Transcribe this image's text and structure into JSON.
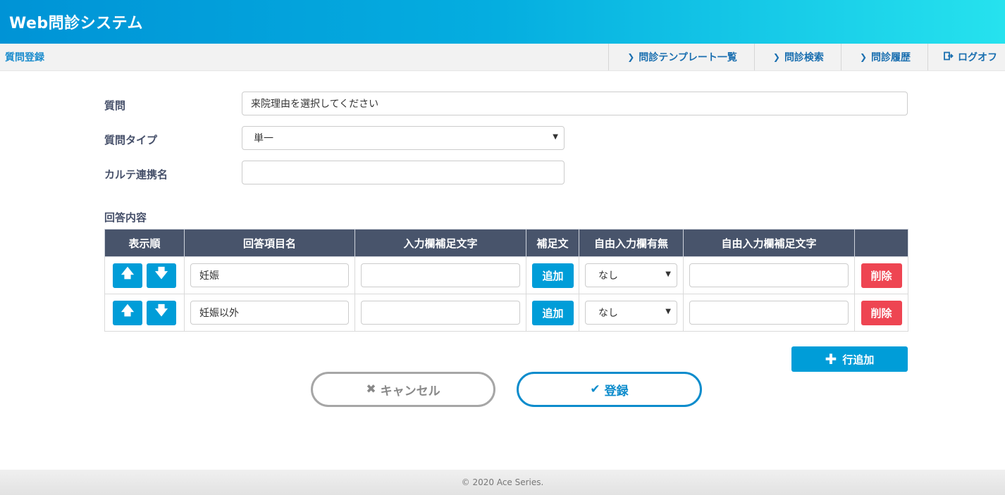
{
  "app": {
    "title": "Web問診システム"
  },
  "subnav": {
    "page_name": "質問登録",
    "links": [
      {
        "label": "問診テンプレート一覧",
        "icon": "chevron-right-icon"
      },
      {
        "label": "問診検索",
        "icon": "chevron-right-icon"
      },
      {
        "label": "問診履歴",
        "icon": "chevron-right-icon"
      },
      {
        "label": "ログオフ",
        "icon": "logout-icon"
      }
    ]
  },
  "form": {
    "question_label": "質問",
    "question_value": "来院理由を選択してください",
    "type_label": "質問タイプ",
    "type_value": "単一",
    "karte_label": "カルテ連携名",
    "karte_value": ""
  },
  "answers": {
    "section_label": "回答内容",
    "columns": [
      "表示順",
      "回答項目名",
      "入力欄補足文字",
      "補足文",
      "自由入力欄有無",
      "自由入力欄補足文字",
      ""
    ],
    "rows": [
      {
        "name": "妊娠",
        "supplement": "",
        "add_label": "追加",
        "free_input": "なし",
        "free_supplement": "",
        "delete_label": "削除"
      },
      {
        "name": "妊娠以外",
        "supplement": "",
        "add_label": "追加",
        "free_input": "なし",
        "free_supplement": "",
        "delete_label": "削除"
      }
    ],
    "add_row_label": "行追加"
  },
  "actions": {
    "cancel_label": "キャンセル",
    "submit_label": "登録"
  },
  "footer": {
    "copyright": "© 2020 Ace Series."
  },
  "colors": {
    "accent": "#009dd8",
    "header_dark": "#48546b",
    "danger": "#ee4552"
  }
}
